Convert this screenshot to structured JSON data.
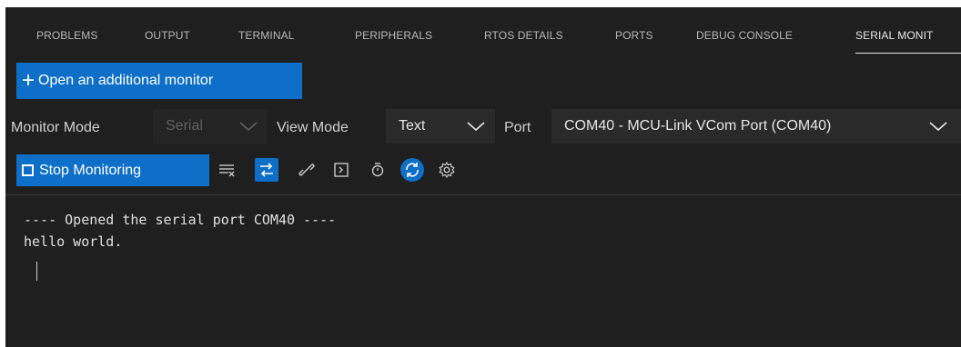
{
  "tabs": [
    {
      "label": "PROBLEMS",
      "active": false
    },
    {
      "label": "OUTPUT",
      "active": false
    },
    {
      "label": "TERMINAL",
      "active": false
    },
    {
      "label": "PERIPHERALS",
      "active": false
    },
    {
      "label": "RTOS DETAILS",
      "active": false
    },
    {
      "label": "PORTS",
      "active": false
    },
    {
      "label": "DEBUG CONSOLE",
      "active": false
    },
    {
      "label": "SERIAL MONIT",
      "active": true
    }
  ],
  "open_button": {
    "plus": "+",
    "label": "Open an additional monitor"
  },
  "modes": {
    "monitor_mode_label": "Monitor Mode",
    "monitor_mode_value": "Serial",
    "view_mode_label": "View Mode",
    "view_mode_value": "Text",
    "port_label": "Port",
    "port_value": "COM40 - MCU-Link VCom Port (COM40)"
  },
  "toolbar": {
    "stop_label": "Stop Monitoring",
    "icons": [
      {
        "name": "clear-output-icon",
        "active": false
      },
      {
        "name": "toggle-mode-icon",
        "active": true
      },
      {
        "name": "link-icon",
        "active": false
      },
      {
        "name": "terminal-icon",
        "active": false
      },
      {
        "name": "timestamp-icon",
        "active": false
      },
      {
        "name": "auto-scroll-icon",
        "active": true
      },
      {
        "name": "settings-gear-icon",
        "active": false
      }
    ]
  },
  "output": {
    "lines": [
      "---- Opened the serial port COM40 ----",
      "hello world."
    ]
  },
  "colors": {
    "panel_bg": "#1f1f1f",
    "accent": "#0e6fc9",
    "text": "#e0e0e0",
    "muted": "#b8b8b8"
  }
}
